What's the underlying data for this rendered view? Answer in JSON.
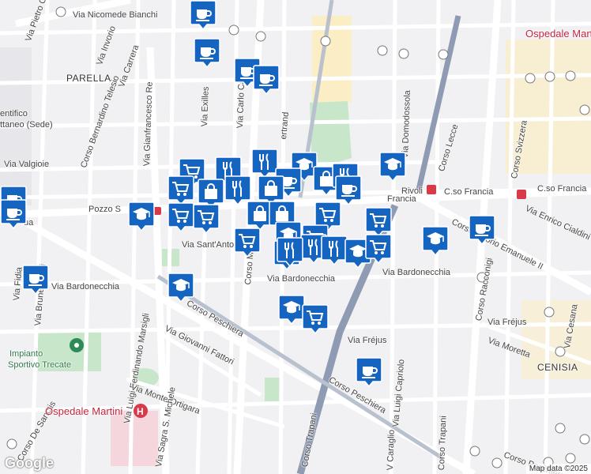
{
  "map": {
    "street_labels": [
      {
        "text": "Via Nicomede Bianchi"
      },
      {
        "text": "Via Pietro Cossa"
      },
      {
        "text": "Via Invorio"
      },
      {
        "text": "Via Carrera"
      },
      {
        "text": "PARELLA"
      },
      {
        "text": "Corso Bernardino Telesio"
      },
      {
        "text": "Via Gianfrancesco Re"
      },
      {
        "text": "Via Exilles"
      },
      {
        "text": "Via Carlo Capelli"
      },
      {
        "text": "ertrand"
      },
      {
        "text": "Via Domodossola"
      },
      {
        "text": "Corso Lecce"
      },
      {
        "text": "Corso Svizzera"
      },
      {
        "text": "Via Valgioie"
      },
      {
        "text": "Pozzo S"
      },
      {
        "text": "Francia"
      },
      {
        "text": "Rivoli"
      },
      {
        "text": "C.so Francia"
      },
      {
        "text": "C.so Francia"
      },
      {
        "text": "Via Enrico Cialdini"
      },
      {
        "text": "Corso Vittorio Emanuele II"
      },
      {
        "text": "Corso Racconigi"
      },
      {
        "text": "Via Sant'Anto"
      },
      {
        "text": "Corso Monte"
      },
      {
        "text": "Via Bardonecchia"
      },
      {
        "text": "Via Bardonecchia"
      },
      {
        "text": "Via Bardonecchia"
      },
      {
        "text": "Via Fidia"
      },
      {
        "text": "Via Brunelleschi"
      },
      {
        "text": "Corso Peschiera"
      },
      {
        "text": "Via Giovanni Fattori"
      },
      {
        "text": "Via Luigi Ferdinando Marsigli"
      },
      {
        "text": "Corso Trapani"
      },
      {
        "text": "Via Luigi Capriolo"
      },
      {
        "text": "V Caraglio"
      },
      {
        "text": "Via Fréjus"
      },
      {
        "text": "Via Fréjus"
      },
      {
        "text": "Via Moretta"
      },
      {
        "text": "Via Cesana"
      },
      {
        "text": "CENISIA"
      },
      {
        "text": "Corso Peschiera"
      },
      {
        "text": "Corso Peschiera"
      },
      {
        "text": "Via Monte Ortigara"
      },
      {
        "text": "Via Sagra S. Michele"
      },
      {
        "text": "Corso De Sanctis"
      },
      {
        "text": "Corso Trapani"
      },
      {
        "text": "entifico"
      },
      {
        "text": "ttaneo (Sede)"
      },
      {
        "text": "Impianto"
      },
      {
        "text": "Sportivo Trecate"
      },
      {
        "text": "Ospedale Martini"
      },
      {
        "text": "Ospedale Marti"
      },
      {
        "text": "ua"
      }
    ],
    "attribution": "Map data ©2025",
    "logo_text": "Google",
    "colors": {
      "background": "#f1f1f3",
      "road": "#ffffff",
      "highway": "#8e9bb3",
      "park": "#c8e6c9",
      "marker_blue": "#1565c0",
      "hospital_red": "#d93a4a",
      "school_tan": "#fbeec4"
    },
    "markers": [
      {
        "icon": "coffee-icon"
      },
      {
        "icon": "coffee-icon"
      },
      {
        "icon": "coffee-icon"
      },
      {
        "icon": "coffee-icon"
      },
      {
        "icon": "cart-icon"
      },
      {
        "icon": "fork-knife-icon"
      },
      {
        "icon": "fork-knife-icon"
      },
      {
        "icon": "shopping-bag-icon"
      },
      {
        "icon": "graduation-cap-icon"
      },
      {
        "icon": "coffee-icon"
      },
      {
        "icon": "shopping-bag-icon"
      },
      {
        "icon": "fork-knife-icon"
      },
      {
        "icon": "coffee-icon"
      },
      {
        "icon": "graduation-cap-icon"
      },
      {
        "icon": "coffee-icon"
      },
      {
        "icon": "coffee-icon"
      },
      {
        "icon": "cart-icon"
      },
      {
        "icon": "shopping-bag-icon"
      },
      {
        "icon": "fork-knife-icon"
      },
      {
        "icon": "graduation-cap-icon"
      },
      {
        "icon": "cart-icon"
      },
      {
        "icon": "cart-icon"
      },
      {
        "icon": "shopping-bag-icon"
      },
      {
        "icon": "shopping-bag-icon"
      },
      {
        "icon": "cart-icon"
      },
      {
        "icon": "cart-icon"
      },
      {
        "icon": "cart-icon"
      },
      {
        "icon": "cart-icon"
      },
      {
        "icon": "graduation-cap-icon"
      },
      {
        "icon": "graduation-cap-icon"
      },
      {
        "icon": "fork-knife-icon"
      },
      {
        "icon": "fork-knife-icon"
      },
      {
        "icon": "fork-knife-icon"
      },
      {
        "icon": "fork-knife-icon"
      },
      {
        "icon": "graduation-cap-icon"
      },
      {
        "icon": "cart-icon"
      },
      {
        "icon": "graduation-cap-icon"
      },
      {
        "icon": "coffee-icon"
      },
      {
        "icon": "coffee-icon"
      },
      {
        "icon": "graduation-cap-icon"
      },
      {
        "icon": "cart-icon"
      },
      {
        "icon": "coffee-icon"
      }
    ]
  }
}
